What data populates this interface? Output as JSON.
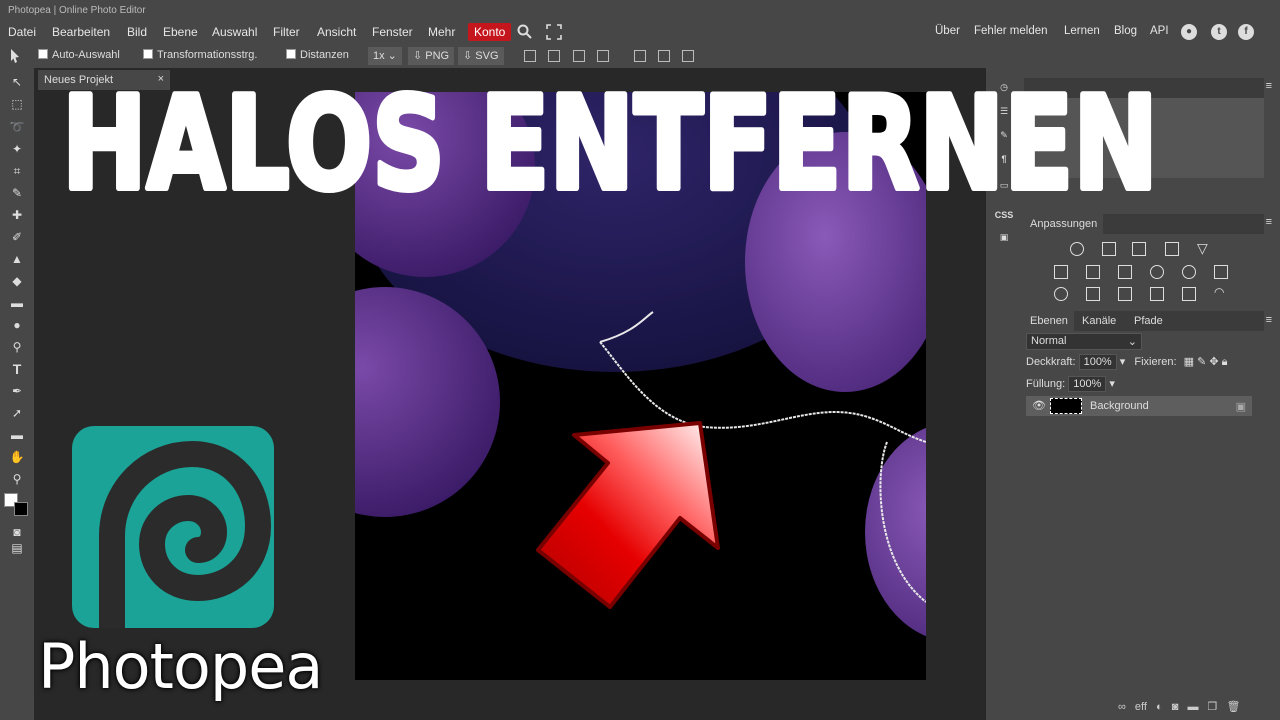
{
  "window": {
    "title": "Photopea | Online Photo Editor"
  },
  "menu": {
    "items": [
      "Datei",
      "Bearbeiten",
      "Bild",
      "Ebene",
      "Auswahl",
      "Filter",
      "Ansicht",
      "Fenster",
      "Mehr"
    ],
    "konto": "Konto",
    "right_items": [
      "Über",
      "Fehler melden",
      "Lernen",
      "Blog",
      "API"
    ]
  },
  "options": {
    "auto_select": "Auto-Auswahl",
    "transform": "Transformationsstrg.",
    "distances": "Distanzen",
    "zoom": "1x",
    "png": "PNG",
    "svg": "SVG"
  },
  "document": {
    "tab_label": "Neues Projekt",
    "close": "×"
  },
  "side_strip": {
    "css_label": "CSS"
  },
  "panels": {
    "adjustments_tab": "Anpassungen",
    "tabs": [
      "Ebenen",
      "Kanäle",
      "Pfade"
    ],
    "blend_mode": "Normal",
    "opacity_label": "Deckkraft:",
    "opacity_value": "100%",
    "lock_label": "Fixieren:",
    "fill_label": "Füllung:",
    "fill_value": "100%",
    "layer_name": "Background",
    "bottom_fx": "eff"
  },
  "overlay": {
    "headline": "HALOS ENTFERNEN",
    "logo_text": "Photopea"
  },
  "colors": {
    "brand_teal": "#1aa396",
    "konto_red": "#c6161d",
    "arrow_red": "#e60000",
    "panel_bg": "#474747",
    "workspace_bg": "#282828"
  }
}
